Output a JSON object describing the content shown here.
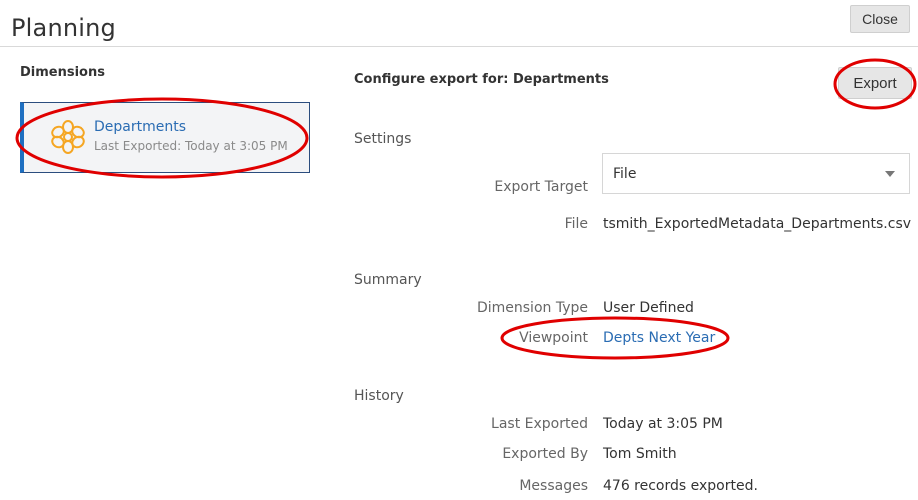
{
  "page": {
    "title": "Planning",
    "close_label": "Close"
  },
  "dimensions": {
    "heading": "Dimensions",
    "items": [
      {
        "name": "Departments",
        "subtitle": "Last Exported: Today at 3:05 PM",
        "icon": "flower-icon"
      }
    ]
  },
  "configure": {
    "heading": "Configure export for: Departments",
    "export_label": "Export",
    "settings": {
      "heading": "Settings",
      "export_target_label": "Export Target",
      "export_target_value": "File",
      "file_label": "File",
      "file_value": "tsmith_ExportedMetadata_Departments.csv"
    },
    "summary": {
      "heading": "Summary",
      "dimension_type_label": "Dimension Type",
      "dimension_type_value": "User Defined",
      "viewpoint_label": "Viewpoint",
      "viewpoint_value": "Depts Next Year"
    },
    "history": {
      "heading": "History",
      "last_exported_label": "Last Exported",
      "last_exported_value": "Today at 3:05 PM",
      "exported_by_label": "Exported By",
      "exported_by_value": "Tom Smith",
      "messages_label": "Messages",
      "messages_value": "476 records exported."
    }
  },
  "colors": {
    "accent": "#1e6fc1",
    "link": "#2a6cb3",
    "annotation": "#e00000",
    "icon": "#f5a623"
  }
}
